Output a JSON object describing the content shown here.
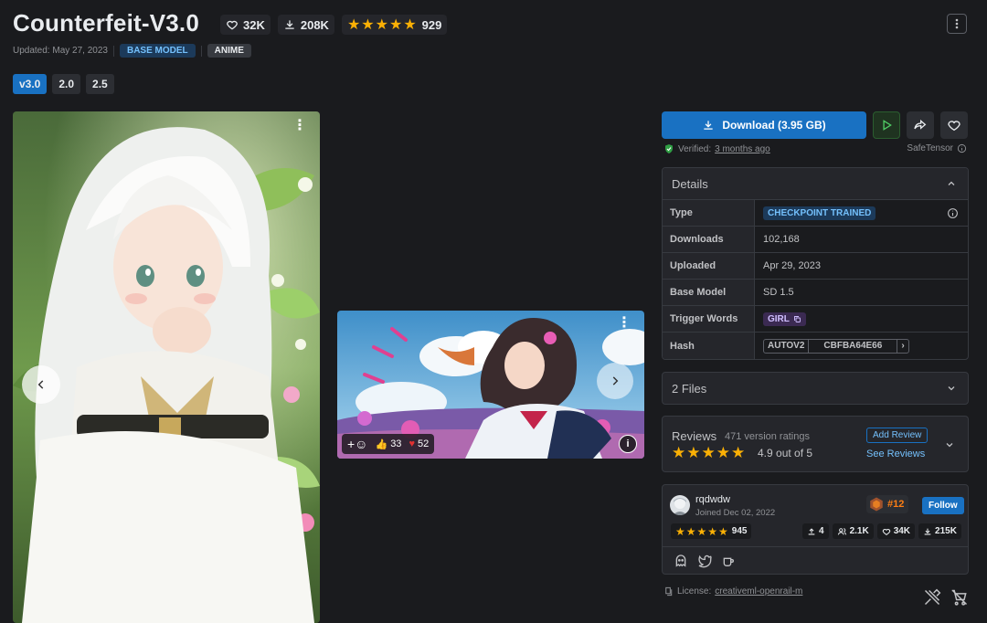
{
  "header": {
    "title": "Counterfeit-V3.0",
    "likes": "32K",
    "downloads": "208K",
    "rating_stars": "★★★★★",
    "rating_count": "929",
    "updated": "Updated: May 27, 2023",
    "badges": [
      "BASE MODEL",
      "ANIME"
    ]
  },
  "versions": [
    "v3.0",
    "2.0",
    "2.5"
  ],
  "gallery": {
    "reactions": {
      "likes": "33",
      "hearts": "52"
    }
  },
  "actions": {
    "download_label": "Download (3.95 GB)",
    "verified_prefix": "Verified:",
    "verified_when": "3 months ago",
    "safetensor": "SafeTensor"
  },
  "details": {
    "heading": "Details",
    "type_label": "Type",
    "type_value": "CHECKPOINT TRAINED",
    "downloads_label": "Downloads",
    "downloads_value": "102,168",
    "uploaded_label": "Uploaded",
    "uploaded_value": "Apr 29, 2023",
    "base_label": "Base Model",
    "base_value": "SD 1.5",
    "trigger_label": "Trigger Words",
    "trigger_value": "GIRL",
    "hash_label": "Hash",
    "hash_type": "AUTOV2",
    "hash_value": "CBFBA64E66"
  },
  "files": {
    "label": "2 Files"
  },
  "reviews": {
    "heading": "Reviews",
    "count": "471 version ratings",
    "stars": "★★★★★",
    "score": "4.9 out of 5",
    "add": "Add Review",
    "see": "See Reviews"
  },
  "creator": {
    "name": "rqdwdw",
    "joined": "Joined Dec 02, 2022",
    "rank": "#12",
    "follow": "Follow",
    "stars": "★★★★★",
    "rating_count": "945",
    "uploads": "4",
    "followers": "2.1K",
    "likes": "34K",
    "downloads": "215K"
  },
  "license": {
    "prefix": "License:",
    "name": "creativeml-openrail-m"
  },
  "colors": {
    "accent": "#1971c2",
    "star": "#fab005",
    "background": "#1a1b1e",
    "panel": "#25262b"
  }
}
